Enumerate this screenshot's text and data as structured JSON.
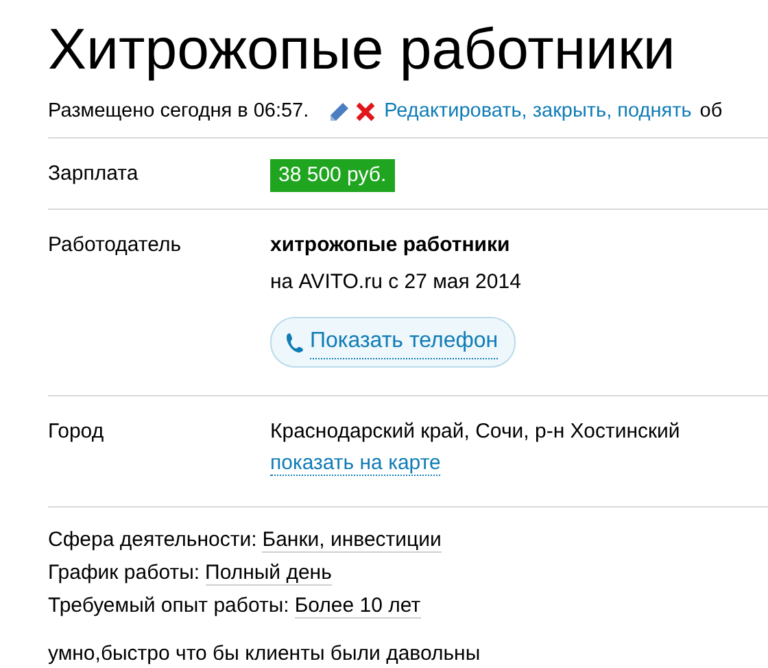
{
  "title": "Хитрожопые работники",
  "meta": {
    "posted": "Размещено сегодня в 06:57.",
    "manage_link": "Редактировать, закрыть, поднять",
    "trailing": "об"
  },
  "fields": [
    {
      "kind": "salary",
      "label": "Зарплата",
      "value": "38 500 руб."
    },
    {
      "kind": "employer",
      "label": "Работодатель",
      "name": "хитрожопые работники",
      "since": "на AVITO.ru с 27 мая 2014",
      "phone_button": "Показать телефон"
    },
    {
      "kind": "city",
      "label": "Город",
      "value": "Краснодарский край, Сочи, р-н Хостинский",
      "map_link": "показать на карте"
    }
  ],
  "params": [
    {
      "label": "Сфера деятельности:",
      "value": "Банки, инвестиции"
    },
    {
      "label": "График работы:",
      "value": "Полный день"
    },
    {
      "label": "Требуемый опыт работы:",
      "value": "Более 10 лет"
    }
  ],
  "description": "умно,быстро что бы клиенты были давольны"
}
